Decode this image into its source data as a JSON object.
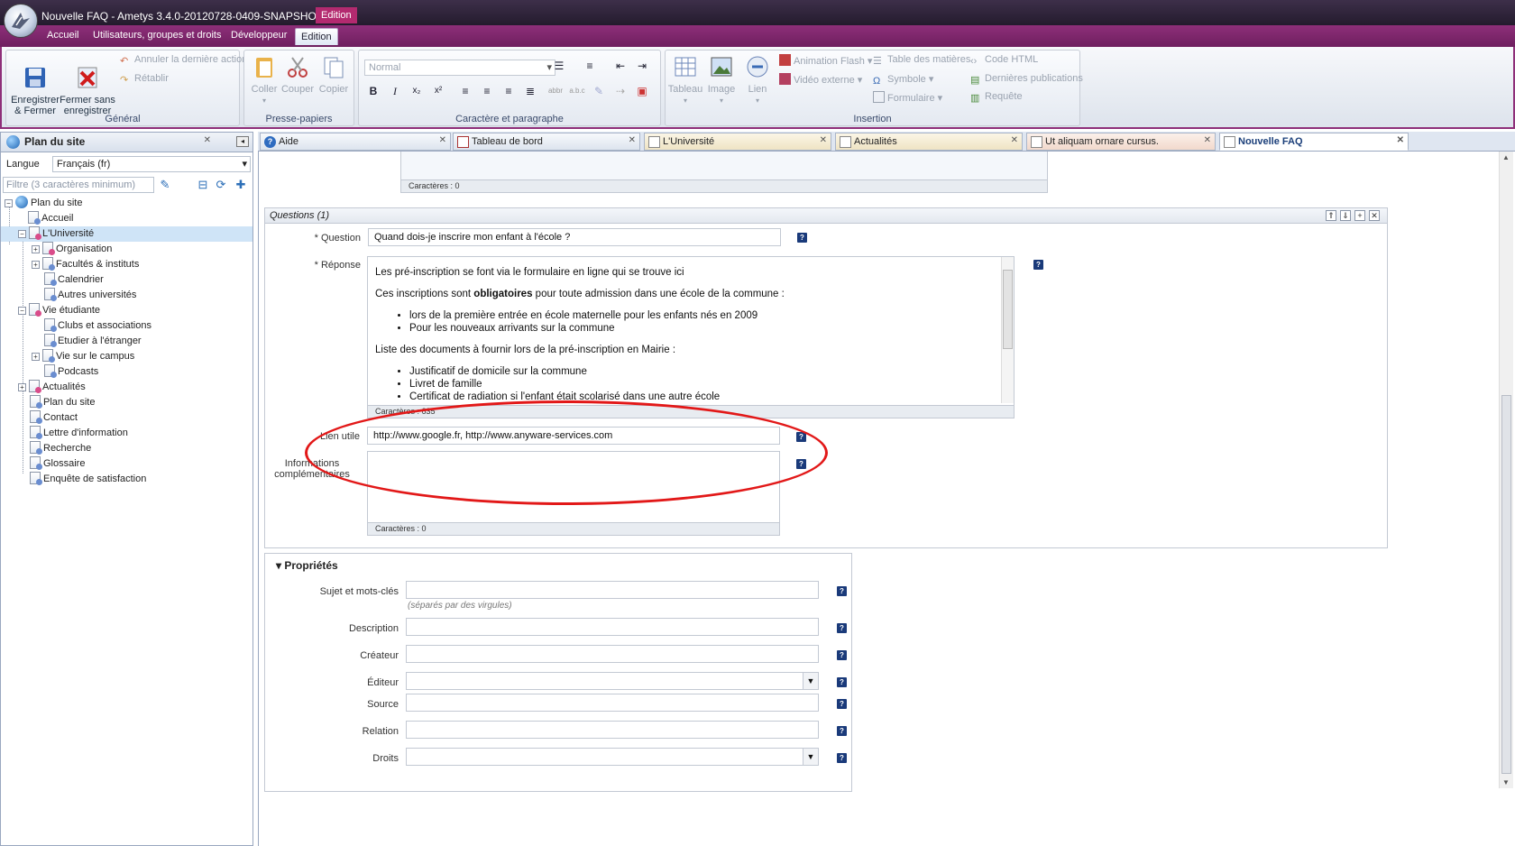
{
  "window": {
    "title": "Nouvelle FAQ - Ametys 3.4.0-20120728-0409-SNAPSHOT",
    "context_tab": "Edition"
  },
  "ribbon_tabs": [
    "Accueil",
    "Utilisateurs, groupes et droits",
    "Développeur",
    "Edition"
  ],
  "ribbon": {
    "general": {
      "label": "Général",
      "save": "Enregistrer\n& Fermer",
      "close_nosave": "Fermer sans\nenregistrer",
      "undo": "Annuler la dernière action",
      "redo": "Rétablir"
    },
    "clipboard": {
      "label": "Presse-papiers",
      "paste": "Coller",
      "cut": "Couper",
      "copy": "Copier"
    },
    "format": {
      "label": "Caractère et paragraphe",
      "style_value": "Normal"
    },
    "insert": {
      "label": "Insertion",
      "table": "Tableau",
      "image": "Image",
      "link": "Lien",
      "flash": "Animation Flash",
      "video": "Vidéo externe",
      "toc": "Table des matières",
      "symbol": "Symbole",
      "form": "Formulaire",
      "html": "Code HTML",
      "last_pubs": "Dernières publications",
      "query": "Requête"
    }
  },
  "sitemap": {
    "title": "Plan du site",
    "lang_label": "Langue",
    "lang_value": "Français (fr)",
    "filter_placeholder": "Filtre (3 caractères minimum)",
    "nodes": [
      "Plan du site",
      "Accueil",
      "L'Université",
      "Organisation",
      "Facultés & instituts",
      "Calendrier",
      "Autres universités",
      "Vie étudiante",
      "Clubs et associations",
      "Etudier à l'étranger",
      "Vie sur le campus",
      "Podcasts",
      "Actualités",
      "Plan du site",
      "Contact",
      "Lettre d'information",
      "Recherche",
      "Glossaire",
      "Enquête de satisfaction"
    ]
  },
  "doc_tabs": [
    "Aide",
    "Tableau de bord",
    "L'Université",
    "Actualités",
    "Ut aliquam ornare cursus.",
    "Nouvelle FAQ"
  ],
  "editor": {
    "top_counter": "Caractères : 0",
    "questions_header": "Questions (1)",
    "question_label": "* Question",
    "question_value": "Quand dois-je inscrire mon enfant  à l'école ?",
    "answer_label": "* Réponse",
    "answer_p1": "Les pré-inscription se font via le formulaire en ligne qui se trouve ici",
    "answer_p2_pre": "Ces inscriptions sont ",
    "answer_p2_bold": "obligatoires",
    "answer_p2_post": " pour toute admission dans une école de la commune :",
    "answer_list1": [
      "lors de la première entrée en école maternelle pour les enfants nés en 2009",
      "Pour les nouveaux arrivants sur la commune"
    ],
    "answer_p3": "Liste des documents à fournir lors de la pré-inscription en Mairie :",
    "answer_list2": [
      "Justificatif de domicile sur la commune",
      "Livret de famille",
      "Certificat de radiation si l'enfant était scolarisé dans une autre école"
    ],
    "answer_counter": "Caractères : 635",
    "link_label": "Lien utile",
    "link_value": "http://www.google.fr, http://www.anyware-services.com",
    "info_label": "Informations\ncomplémentaires",
    "info_counter": "Caractères : 0"
  },
  "properties": {
    "title": "Propriétés",
    "subject_label": "Sujet et mots-clés",
    "subject_hint": "(séparés par des virgules)",
    "description_label": "Description",
    "creator_label": "Créateur",
    "editor_label": "Éditeur",
    "source_label": "Source",
    "relation_label": "Relation",
    "rights_label": "Droits"
  },
  "colors": {
    "ribbon_accent": "#8e2f79",
    "annotation": "#e21818",
    "selection": "#cfe4f7"
  }
}
